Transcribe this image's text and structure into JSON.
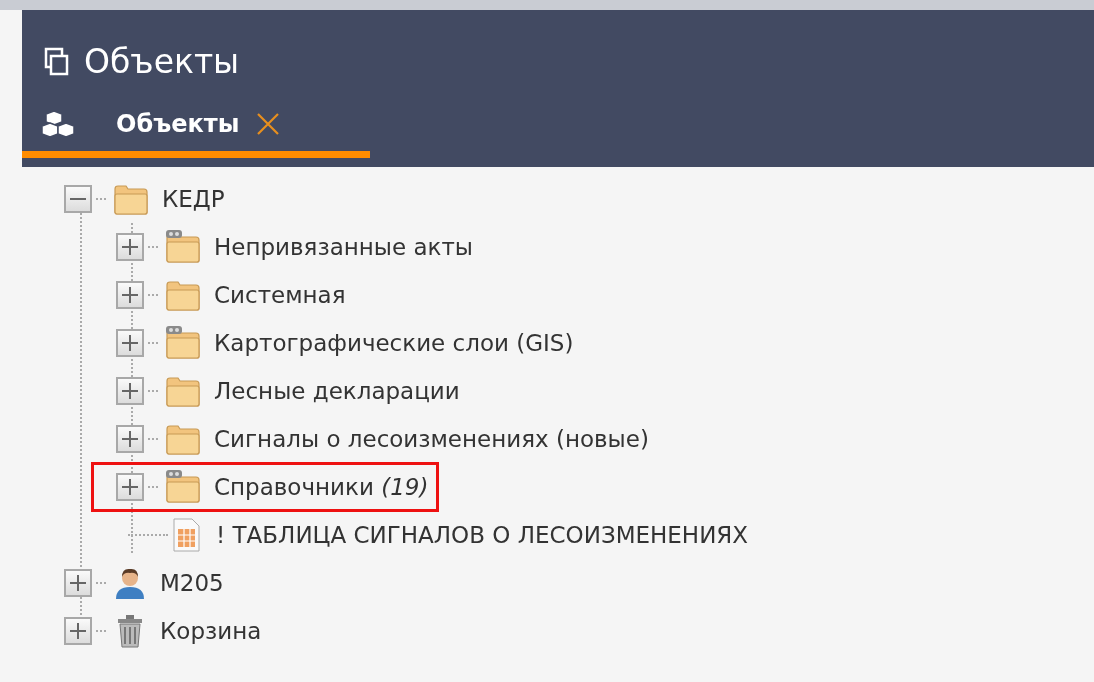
{
  "window": {
    "title": "Объекты"
  },
  "tabs": [
    {
      "label": "Объекты",
      "selected": true
    }
  ],
  "tree": [
    {
      "kind": "folder",
      "label": "КЕДР",
      "linked": false,
      "expanded": true,
      "highlighted": false,
      "children": [
        {
          "kind": "folder",
          "label": "Непривязанные акты",
          "linked": true,
          "expanded": false,
          "highlighted": false
        },
        {
          "kind": "folder",
          "label": "Системная",
          "linked": false,
          "expanded": false,
          "highlighted": false
        },
        {
          "kind": "folder",
          "label": "Картографические слои (GIS)",
          "linked": true,
          "expanded": false,
          "highlighted": false
        },
        {
          "kind": "folder",
          "label": "Лесные декларации",
          "linked": false,
          "expanded": false,
          "highlighted": false
        },
        {
          "kind": "folder",
          "label": "Сигналы о лесоизменениях (новые)",
          "linked": false,
          "expanded": false,
          "highlighted": false
        },
        {
          "kind": "folder",
          "label": "Справочники *(19)*",
          "linked": true,
          "expanded": false,
          "highlighted": true
        },
        {
          "kind": "table",
          "label": "! ТАБЛИЦА СИГНАЛОВ О ЛЕСОИЗМЕНЕНИЯХ",
          "highlighted": false
        }
      ]
    },
    {
      "kind": "user",
      "label": "M205",
      "expanded": false,
      "highlighted": false
    },
    {
      "kind": "trash",
      "label": "Корзина",
      "expanded": false,
      "highlighted": false
    }
  ]
}
